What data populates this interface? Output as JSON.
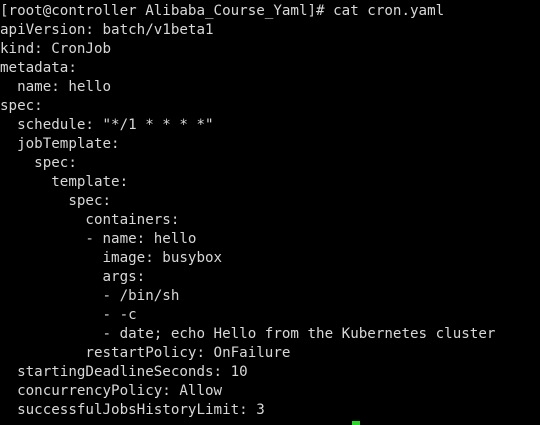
{
  "terminal": {
    "lines": [
      "[root@controller Alibaba_Course_Yaml]# cat cron.yaml",
      "apiVersion: batch/v1beta1",
      "kind: CronJob",
      "metadata:",
      "  name: hello",
      "spec:",
      "  schedule: \"*/1 * * * *\"",
      "  jobTemplate:",
      "    spec:",
      "      template:",
      "        spec:",
      "          containers:",
      "          - name: hello",
      "            image: busybox",
      "            args:",
      "            - /bin/sh",
      "            - -c",
      "            - date; echo Hello from the Kubernetes cluster",
      "          restartPolicy: OnFailure",
      "  startingDeadlineSeconds: 10",
      "  concurrencyPolicy: Allow",
      "  successfulJobsHistoryLimit: 3"
    ],
    "colors": {
      "background": "#000000",
      "foreground": "#d8d8d8",
      "cursor": "#2bd62b"
    }
  }
}
